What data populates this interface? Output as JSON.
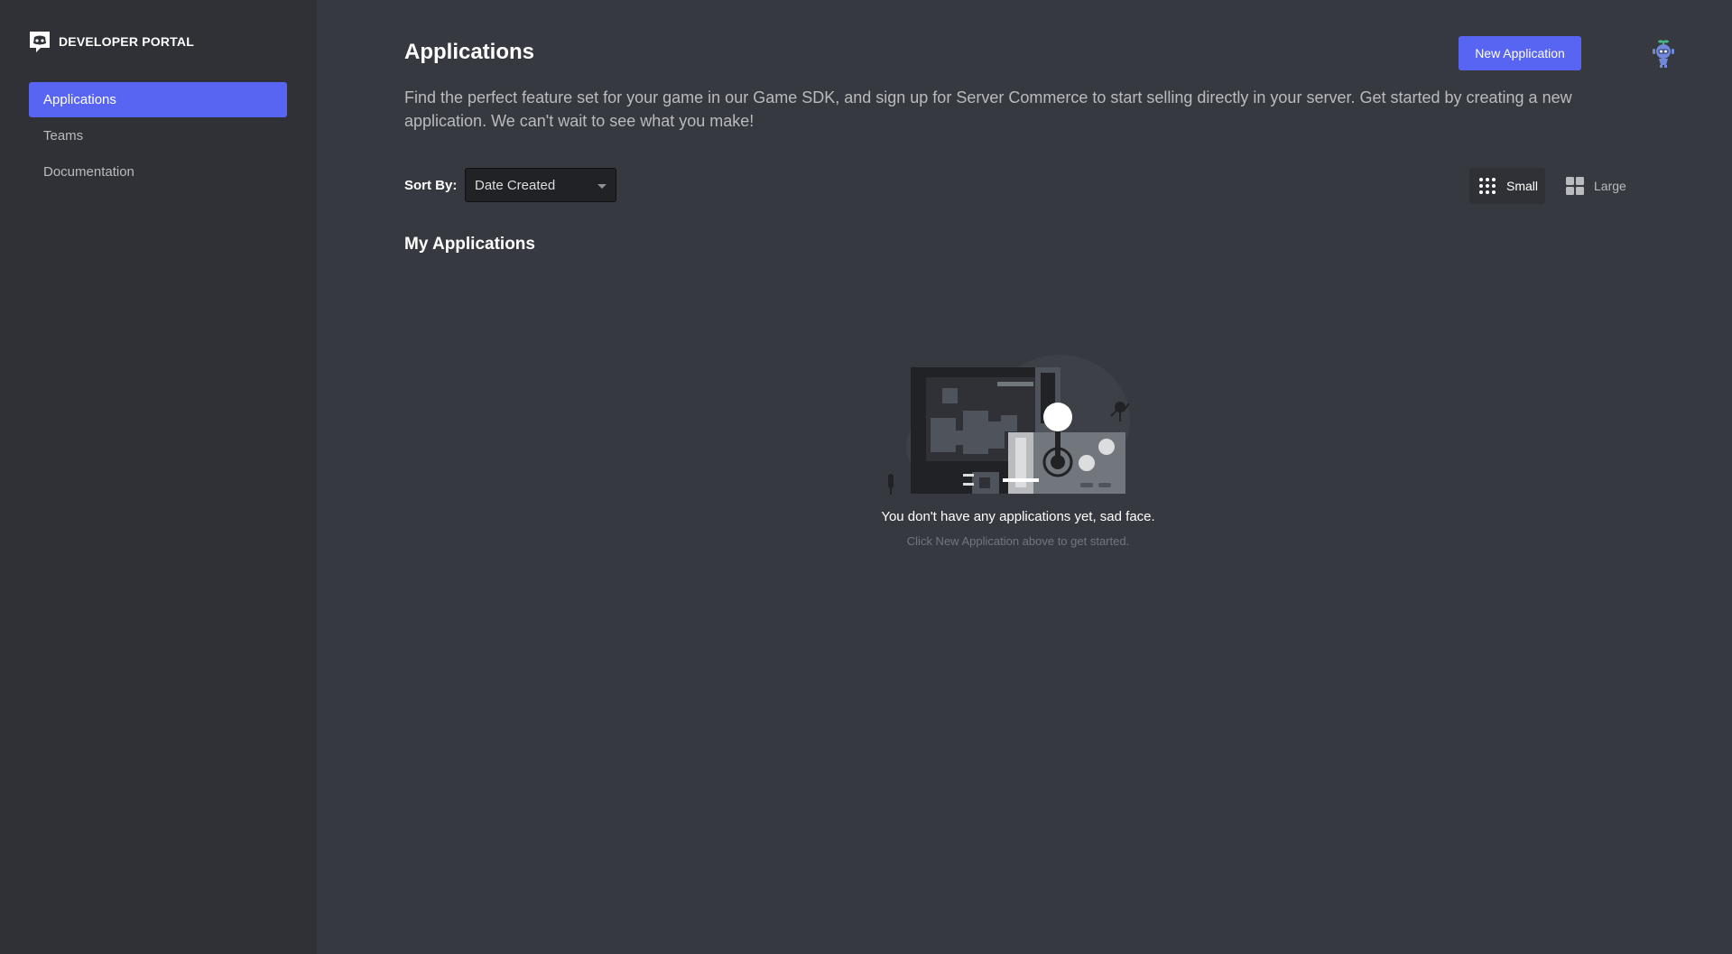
{
  "brand": {
    "title": "DEVELOPER PORTAL",
    "icon": "discord-logo-icon"
  },
  "sidebar": {
    "items": [
      {
        "label": "Applications",
        "active": true
      },
      {
        "label": "Teams",
        "active": false
      },
      {
        "label": "Documentation",
        "active": false
      }
    ]
  },
  "header": {
    "title": "Applications",
    "new_app_label": "New Application",
    "avatar_icon": "robot-avatar-icon",
    "description": "Find the perfect feature set for your game in our Game SDK, and sign up for Server Commerce to start selling directly in your server. Get started by creating a new application. We can't wait to see what you make!"
  },
  "sort": {
    "label": "Sort By:",
    "value": "Date Created"
  },
  "view_size": {
    "small_label": "Small",
    "large_label": "Large",
    "selected": "Small"
  },
  "section": {
    "title": "My Applications",
    "empty_title": "You don't have any applications yet, sad face.",
    "empty_subtitle": "Click New Application above to get started."
  },
  "colors": {
    "accent": "#5865f2",
    "sidebar_bg": "#2f3136",
    "main_bg": "#36393f"
  }
}
